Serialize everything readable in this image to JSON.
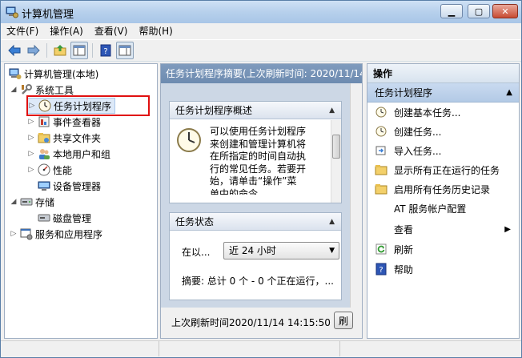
{
  "window": {
    "title": "计算机管理"
  },
  "menu": [
    "文件(F)",
    "操作(A)",
    "查看(V)",
    "帮助(H)"
  ],
  "tree": [
    {
      "label": "计算机管理(本地)",
      "icon": "computer-management-icon",
      "arrow": ""
    },
    {
      "label": "系统工具",
      "icon": "system-tools-icon",
      "arrow": "◢"
    },
    {
      "label": "任务计划程序",
      "icon": "task-scheduler-icon",
      "arrow": "▷"
    },
    {
      "label": "事件查看器",
      "icon": "event-viewer-icon",
      "arrow": "▷"
    },
    {
      "label": "共享文件夹",
      "icon": "shared-folders-icon",
      "arrow": "▷"
    },
    {
      "label": "本地用户和组",
      "icon": "local-users-icon",
      "arrow": "▷"
    },
    {
      "label": "性能",
      "icon": "performance-icon",
      "arrow": "▷"
    },
    {
      "label": "设备管理器",
      "icon": "device-manager-icon",
      "arrow": ""
    },
    {
      "label": "存储",
      "icon": "storage-icon",
      "arrow": "◢"
    },
    {
      "label": "磁盘管理",
      "icon": "disk-management-icon",
      "arrow": ""
    },
    {
      "label": "服务和应用程序",
      "icon": "services-apps-icon",
      "arrow": "▷"
    }
  ],
  "middle": {
    "header": "任务计划程序摘要(上次刷新时间: 2020/11/14",
    "overview": {
      "title": "任务计划程序概述",
      "lines": [
        "可以使用任务计划程序",
        "来创建和管理计算机将",
        "在所指定的时间自动执",
        "行的常见任务。若要开",
        "始，请单击“操作”菜",
        "单中的命令。"
      ]
    },
    "status": {
      "title": "任务状态",
      "label": "在以...",
      "select_value": "近 24 小时",
      "summary": "摘要: 总计 0 个 - 0 个正在运行，..."
    },
    "footer_text": "上次刷新时间2020/11/14 14:15:50",
    "refresh_label": "刷"
  },
  "actions": {
    "header": "操作",
    "group": "任务计划程序",
    "items": [
      {
        "label": "创建基本任务...",
        "icon": "create-basic-task-icon"
      },
      {
        "label": "创建任务...",
        "icon": "create-task-icon"
      },
      {
        "label": "导入任务...",
        "icon": "import-task-icon"
      },
      {
        "label": "显示所有正在运行的任务",
        "icon": "running-tasks-icon"
      },
      {
        "label": "启用所有任务历史记录",
        "icon": "history-folder-icon"
      },
      {
        "label": "AT 服务帐户配置",
        "icon": ""
      },
      {
        "label": "查看",
        "icon": ""
      },
      {
        "label": "刷新",
        "icon": "refresh-icon"
      },
      {
        "label": "帮助",
        "icon": "help-icon"
      }
    ]
  },
  "colors": {
    "highlight": "#e01010",
    "pane_header": "#7592b6",
    "selected_group": "#bcd0e9"
  }
}
